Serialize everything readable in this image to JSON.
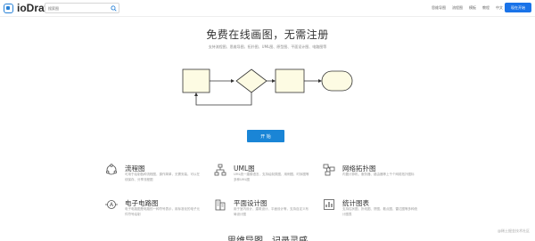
{
  "header": {
    "logo_text": "ioDraw",
    "search_placeholder": "搜索图",
    "nav": [
      "思维导图",
      "流程图",
      "模板",
      "教程",
      "中文"
    ],
    "cta": "现在开始"
  },
  "hero": {
    "title": "免费在线画图，无需注册",
    "subtitle": "支持流程图、思维导图、拓扑图、UML图、原型图、平面设计图、电路图等",
    "start_button": "开 始"
  },
  "features": [
    {
      "title": "流程图",
      "desc": "可用于绘制各种流程图，操作简单，无需安装，可以在线保存、分享流程图"
    },
    {
      "title": "UML图",
      "desc": "UML统一建模语言，支持绘制类图、用例图、时序图等多种UML图"
    },
    {
      "title": "网络拓扑图",
      "desc": "内置计算机、服务器、路由器等上千个网络拓扑图标"
    },
    {
      "title": "电子电路图",
      "desc": "电子电路图是电路的一种符号表示，用标准化的电子元件符号绘制"
    },
    {
      "title": "平面设计图",
      "desc": "用于室内设计、建筑设计、平面设计等，支持自定义布局设计图"
    },
    {
      "title": "统计图表",
      "desc": "支持柱状图、折线图、饼图、散点图、雷达图等多种统计图表"
    }
  ],
  "bottom_title": "思维导图，记录灵感",
  "watermark": "@稀土掘金技术社区",
  "colors": {
    "accent": "#1a85d6",
    "node_fill": "#fdfbe3"
  }
}
